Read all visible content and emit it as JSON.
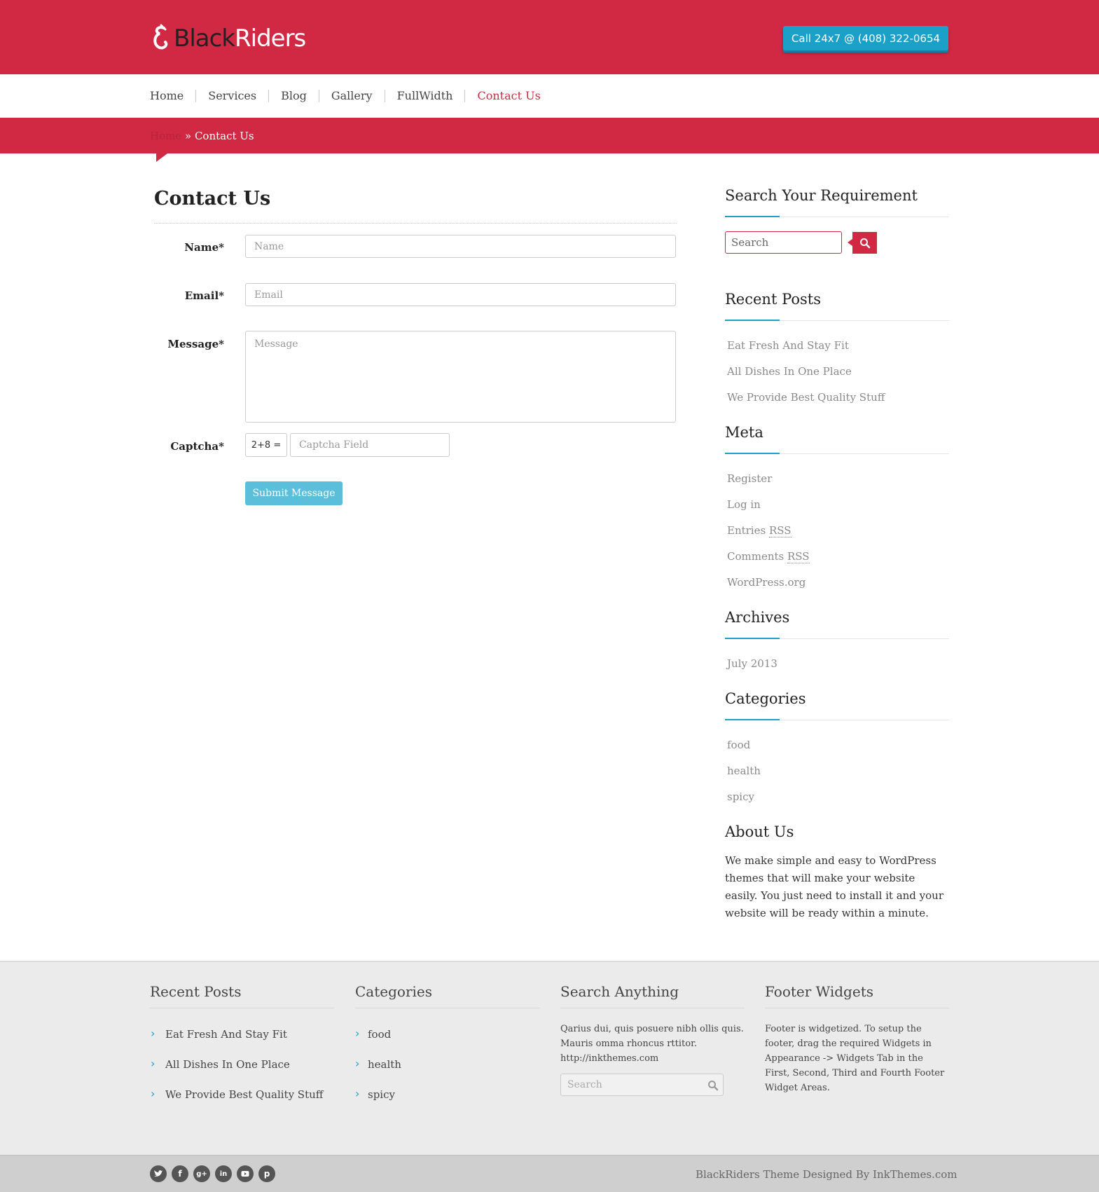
{
  "header": {
    "logo_part1": "Black",
    "logo_part2": "Riders",
    "call_button": "Call 24x7 @ (408) 322-0654"
  },
  "nav": {
    "items": [
      "Home",
      "Services",
      "Blog",
      "Gallery",
      "FullWidth",
      "Contact Us"
    ],
    "active": "Contact Us"
  },
  "breadcrumb": {
    "home": "Home",
    "separator": " » ",
    "current": "Contact Us"
  },
  "main": {
    "title": "Contact Us",
    "form": {
      "name_label": "Name*",
      "name_placeholder": "Name",
      "email_label": "Email*",
      "email_placeholder": "Email",
      "message_label": "Message*",
      "message_placeholder": "Message",
      "captcha_label": "Captcha*",
      "captcha_question": "2+8 =",
      "captcha_placeholder": "Captcha Field",
      "submit_label": "Submit Message"
    }
  },
  "sidebar": {
    "search_title": "Search Your Requirement",
    "search_placeholder": "Search",
    "recent_title": "Recent Posts",
    "recent_posts": [
      "Eat Fresh And Stay Fit",
      "All Dishes In One Place",
      "We Provide Best Quality Stuff"
    ],
    "meta_title": "Meta",
    "meta_links": {
      "register": "Register",
      "login": "Log in",
      "entries": "Entries",
      "comments": "Comments",
      "rss": "RSS",
      "wordpress": "WordPress.org"
    },
    "archives_title": "Archives",
    "archives": [
      "July 2013"
    ],
    "categories_title": "Categories",
    "categories": [
      "food",
      "health",
      "spicy"
    ],
    "about_title": "About Us",
    "about_text": "We make simple and easy to WordPress themes that will make your website easily. You just need to install it and your website will be ready within a minute."
  },
  "footer": {
    "recent_title": "Recent Posts",
    "recent_posts": [
      "Eat Fresh And Stay Fit",
      "All Dishes In One Place",
      "We Provide Best Quality Stuff"
    ],
    "categories_title": "Categories",
    "categories": [
      "food",
      "health",
      "spicy"
    ],
    "search_title": "Search Anything",
    "search_text": "Qarius dui, quis posuere nibh ollis quis. Mauris omma rhoncus rttitor. http://inkthemes.com",
    "search_placeholder": "Search",
    "widgets_title": "Footer Widgets",
    "widgets_text": "Footer is widgetized. To setup the footer, drag the required Widgets in Appearance -> Widgets Tab in the First, Second, Third and Fourth Footer Widget Areas.",
    "credit": "BlackRiders Theme Designed By InkThemes.com"
  },
  "colors": {
    "brand": "#d12944",
    "accent": "#1ba0c8",
    "submit": "#5bbfdc"
  }
}
